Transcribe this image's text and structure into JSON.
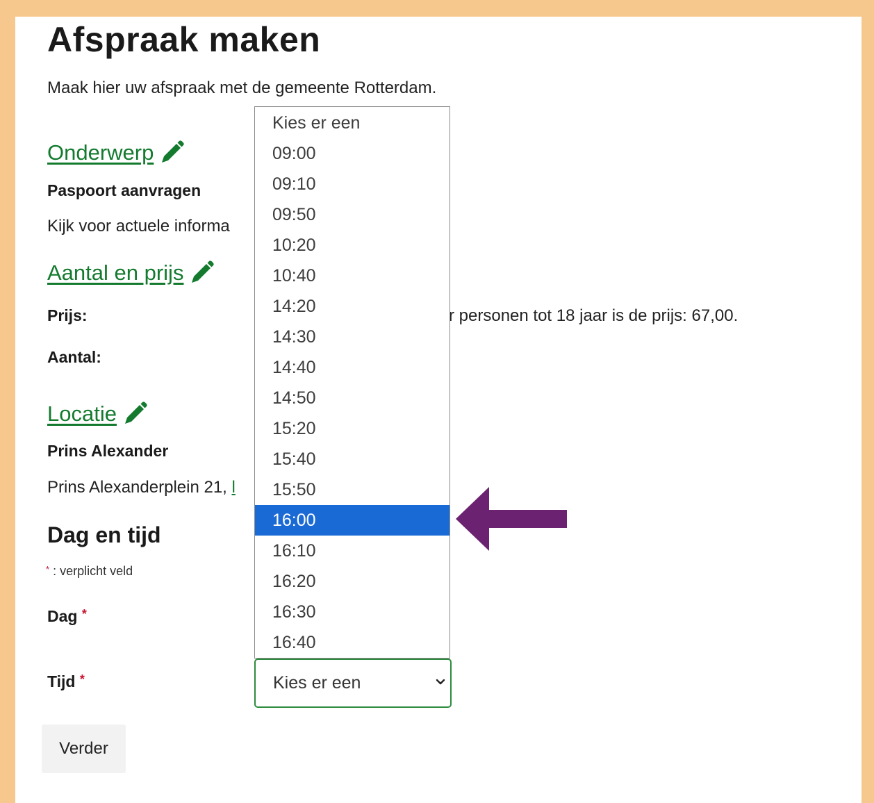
{
  "page": {
    "title": "Afspraak maken",
    "intro": "Maak hier uw afspraak met de gemeente Rotterdam."
  },
  "onderwerp": {
    "heading": "Onderwerp",
    "value": "Paspoort aanvragen",
    "info_visible": "Kijk voor actuele informa"
  },
  "aantal_prijs": {
    "heading": "Aantal en prijs",
    "price_label": "Prijs:",
    "price_text_visible": "r personen tot 18 jaar is de prijs: 67,00.",
    "count_label": "Aantal:"
  },
  "locatie": {
    "heading": "Locatie",
    "name": "Prins Alexander",
    "address_visible": "Prins Alexanderplein 21,",
    "address_link_fragment": "l"
  },
  "dag_tijd": {
    "heading": "Dag en tijd",
    "required_marker": "*",
    "required_note": ": verplicht veld",
    "day_label": "Dag",
    "time_label": "Tijd"
  },
  "time_select": {
    "selected_value": "Kies er een",
    "highlighted_option": "16:00",
    "options": [
      "Kies er een",
      "09:00",
      "09:10",
      "09:50",
      "10:20",
      "10:40",
      "14:20",
      "14:30",
      "14:40",
      "14:50",
      "15:20",
      "15:40",
      "15:50",
      "16:00",
      "16:10",
      "16:20",
      "16:30",
      "16:40"
    ]
  },
  "button": {
    "label": "Verder"
  },
  "colors": {
    "frame": "#f7c88e",
    "link": "#137a2e",
    "highlight": "#1a6ad6",
    "arrow": "#6b2270",
    "required": "#c8102e"
  },
  "icons": {
    "edit": "pencil-icon",
    "select_arrow": "chevron-down-icon",
    "annotation": "arrow-left-icon"
  }
}
